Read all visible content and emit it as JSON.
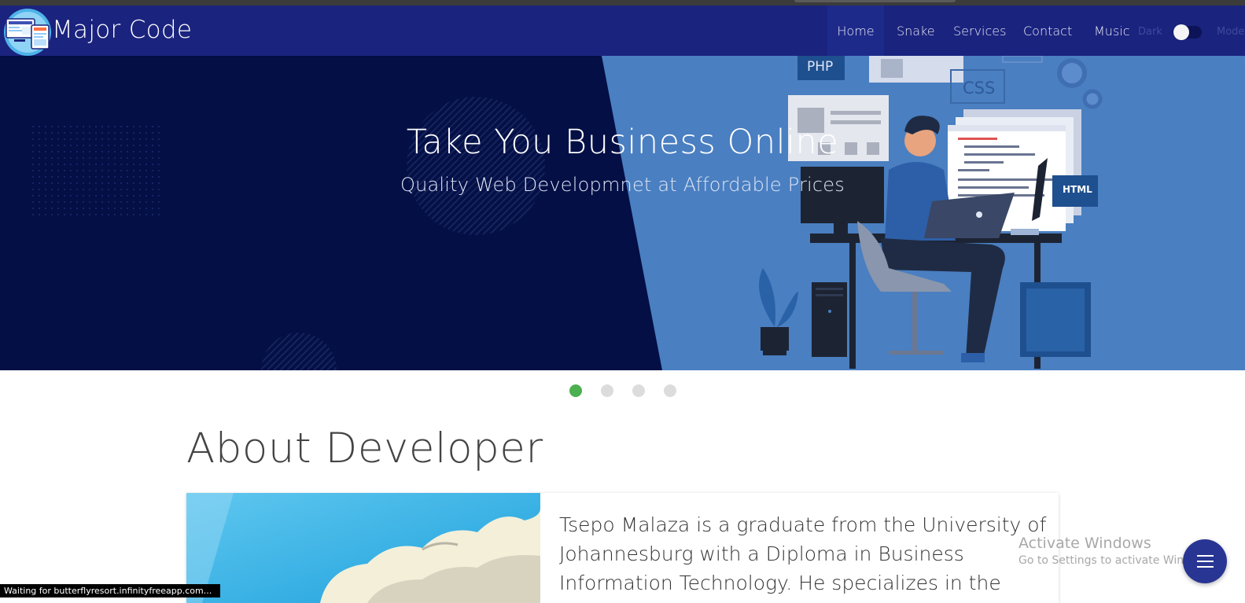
{
  "navbar": {
    "brand": "Major Code",
    "items": [
      {
        "label": "Home",
        "active": true
      },
      {
        "label": "Snake"
      },
      {
        "label": "Services"
      },
      {
        "label": "Contact"
      },
      {
        "label": "Music"
      }
    ],
    "mode_left": "Dark",
    "mode_right": "Mode",
    "toggle_on": false
  },
  "hero": {
    "title": "Take You Business Online",
    "subtitle": "Quality Web Developmnet at Affordable Prices",
    "tags": {
      "php": "PHP",
      "css": "CSS",
      "html": "HTML"
    },
    "slides": 4,
    "active_slide": 1
  },
  "about": {
    "title": "About Developer",
    "text": "Tsepo Malaza is a graduate from the University of Johannesburg with a Diploma in Business Information Technology. He specializes in the"
  },
  "watermark": {
    "line1": "Activate Windows",
    "line2": "Go to Settings to activate Windows."
  },
  "status": "Waiting for butterflyresort.infinityfreeapp.com...",
  "colors": {
    "navbar": "#1a237e",
    "hero_dark": "#030f45",
    "hero_light": "#4a7fc1",
    "dot_active": "#4caf50",
    "fab": "#283593"
  }
}
